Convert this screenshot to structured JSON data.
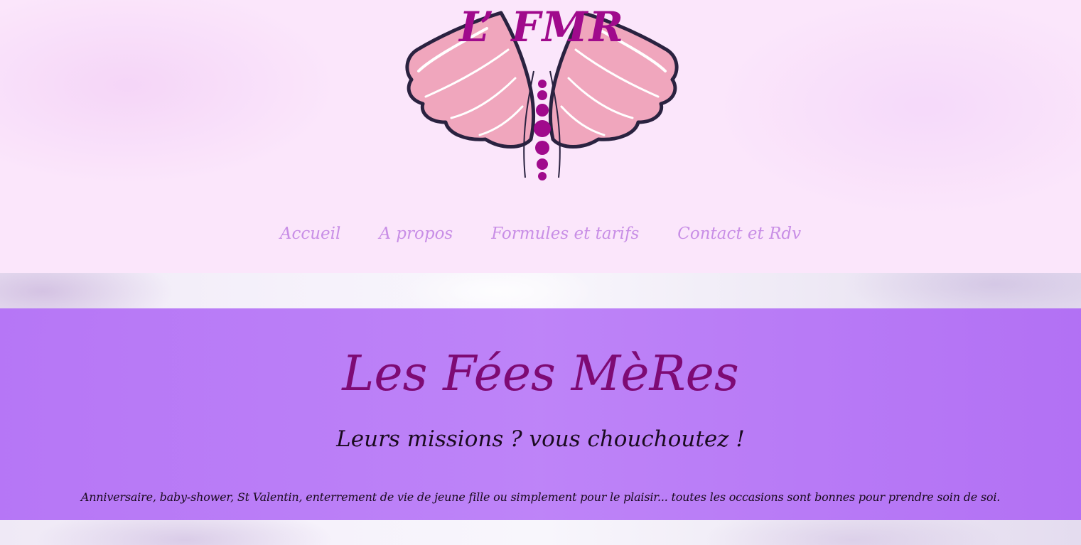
{
  "header": {
    "logo_text": "L’ FMR",
    "logo_icon": "winged-spine-icon"
  },
  "nav": {
    "items": [
      {
        "label": "Accueil"
      },
      {
        "label": "A propos"
      },
      {
        "label": "Formules et tarifs"
      },
      {
        "label": "Contact et Rdv"
      }
    ]
  },
  "hero": {
    "title": "Les Fées MèRes",
    "subtitle": "Leurs missions ? vous chouchoutez !",
    "text": "Anniversaire, baby-shower, St Valentin, enterrement de vie de jeune fille ou simplement pour le plaisir... toutes les occasions sont bonnes pour prendre soin de soi."
  },
  "colors": {
    "header_background": "#fbe6fb",
    "nav_text": "#c88ee6",
    "hero_background": "#b66ef5",
    "hero_title": "#7e0a74",
    "logo_accent": "#a00a8c",
    "wing_pink": "#f0a6bd"
  }
}
